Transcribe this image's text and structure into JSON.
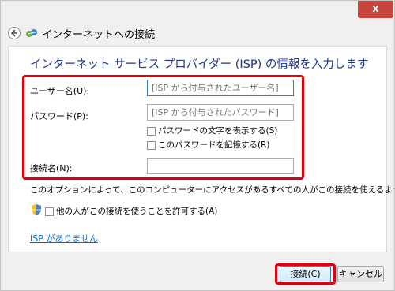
{
  "window": {
    "title": "インターネットへの接続",
    "close_glyph": "x"
  },
  "heading": "インターネット サービス プロバイダー (ISP) の情報を入力します",
  "form": {
    "username_label": "ユーザー名(U):",
    "username_placeholder": "[ISP から付与されたユーザー名]",
    "password_label": "パスワード(P):",
    "password_placeholder": "[ISP から付与されたパスワード]",
    "show_password_label": "パスワードの文字を表示する(S)",
    "remember_password_label": "このパスワードを記憶する(R)",
    "connection_name_label": "接続名(N):",
    "connection_name_value": ""
  },
  "description": "このオプションによって、このコンピューターにアクセスがあるすべての人がこの接続を使えるようになります。",
  "allow_others_label": "他の人がこの接続を使うことを許可する(A)",
  "no_isp_link": "ISP がありません",
  "buttons": {
    "connect": "接続(C)",
    "cancel": "キャンセル"
  },
  "colors": {
    "highlight": "#e0000b",
    "heading": "#1e3287",
    "link": "#0066cc",
    "close": "#c7453b"
  },
  "icons": [
    "back-arrow-icon",
    "network-icon",
    "shield-icon",
    "close-icon"
  ]
}
